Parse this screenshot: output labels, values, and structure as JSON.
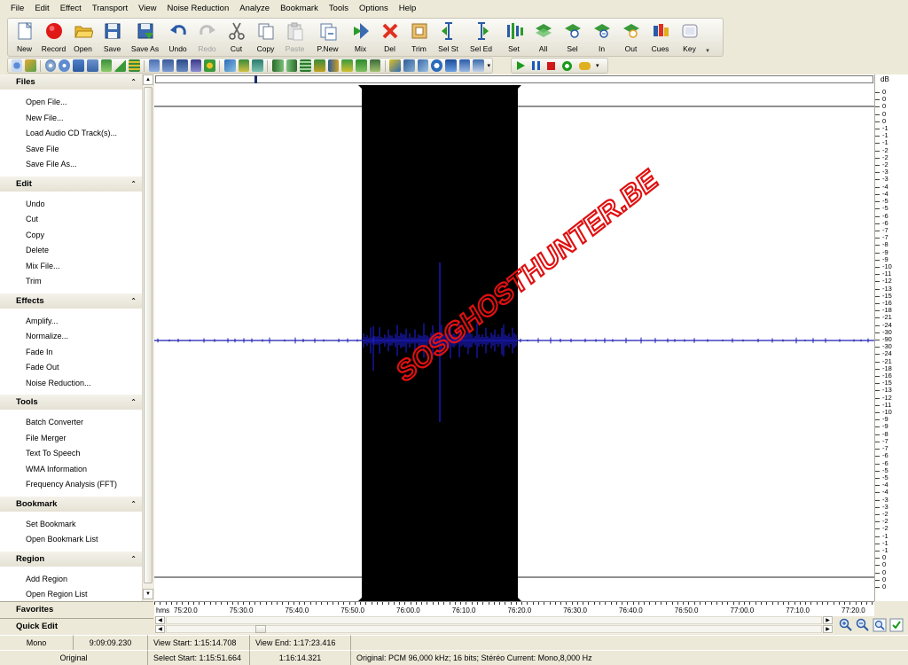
{
  "menu": [
    "File",
    "Edit",
    "Effect",
    "Transport",
    "View",
    "Noise Reduction",
    "Analyze",
    "Bookmark",
    "Tools",
    "Options",
    "Help"
  ],
  "toolbar": [
    {
      "id": "new",
      "label": "New",
      "icon": "new-file-icon",
      "enabled": true
    },
    {
      "id": "record",
      "label": "Record",
      "icon": "record-icon",
      "enabled": true
    },
    {
      "id": "open",
      "label": "Open",
      "icon": "folder-open-icon",
      "enabled": true
    },
    {
      "id": "save",
      "label": "Save",
      "icon": "floppy-save-icon",
      "enabled": true
    },
    {
      "id": "save_as",
      "label": "Save As",
      "icon": "save-as-icon",
      "enabled": true
    },
    {
      "id": "undo",
      "label": "Undo",
      "icon": "undo-icon",
      "enabled": true
    },
    {
      "id": "redo",
      "label": "Redo",
      "icon": "redo-icon",
      "enabled": false
    },
    {
      "id": "cut",
      "label": "Cut",
      "icon": "scissors-icon",
      "enabled": true
    },
    {
      "id": "copy",
      "label": "Copy",
      "icon": "copy-icon",
      "enabled": true
    },
    {
      "id": "paste",
      "label": "Paste",
      "icon": "paste-icon",
      "enabled": false
    },
    {
      "id": "p_new",
      "label": "P.New",
      "icon": "paste-new-icon",
      "enabled": true
    },
    {
      "id": "mix",
      "label": "Mix",
      "icon": "mix-icon",
      "enabled": true
    },
    {
      "id": "del",
      "label": "Del",
      "icon": "delete-x-icon",
      "enabled": true
    },
    {
      "id": "trim",
      "label": "Trim",
      "icon": "trim-icon",
      "enabled": true
    },
    {
      "id": "sel_st",
      "label": "Sel St",
      "icon": "select-start-icon",
      "enabled": true
    },
    {
      "id": "sel_ed",
      "label": "Sel Ed",
      "icon": "select-end-icon",
      "enabled": true
    },
    {
      "id": "set",
      "label": "Set",
      "icon": "set-bookmark-icon",
      "enabled": true
    },
    {
      "id": "all",
      "label": "All",
      "icon": "select-all-icon",
      "enabled": true
    },
    {
      "id": "sel",
      "label": "Sel",
      "icon": "zoom-selection-icon",
      "enabled": true
    },
    {
      "id": "in",
      "label": "In",
      "icon": "zoom-in-icon",
      "enabled": true
    },
    {
      "id": "out",
      "label": "Out",
      "icon": "zoom-out-icon",
      "enabled": true
    },
    {
      "id": "cues",
      "label": "Cues",
      "icon": "cues-icon",
      "enabled": true
    },
    {
      "id": "key",
      "label": "Key",
      "icon": "key-icon",
      "enabled": true
    }
  ],
  "side_panel": {
    "sections": [
      {
        "title": "Files",
        "items": [
          "Open File...",
          "New File...",
          "Load Audio CD Track(s)...",
          "Save File",
          "Save File As..."
        ]
      },
      {
        "title": "Edit",
        "items": [
          "Undo",
          "Cut",
          "Copy",
          "Delete",
          "Mix File...",
          "Trim"
        ]
      },
      {
        "title": "Effects",
        "items": [
          "Amplify...",
          "Normalize...",
          "Fade In",
          "Fade Out",
          "Noise Reduction..."
        ]
      },
      {
        "title": "Tools",
        "items": [
          "Batch Converter",
          "File Merger",
          "Text To Speech",
          "WMA Information",
          "Frequency Analysis (FFT)"
        ]
      },
      {
        "title": "Bookmark",
        "items": [
          "Set Bookmark",
          "Open Bookmark List"
        ]
      },
      {
        "title": "Region",
        "items": [
          "Add Region",
          "Open Region List"
        ]
      }
    ],
    "favorites": "Favorites",
    "quick_edit": "Quick Edit"
  },
  "watermark": "SOSGHOSTHUNTER.BE",
  "db_scale": {
    "title": "dB",
    "labels": [
      "0",
      "0",
      "0",
      "0",
      "0",
      "-1",
      "-1",
      "-1",
      "-2",
      "-2",
      "-2",
      "-3",
      "-3",
      "-4",
      "-4",
      "-5",
      "-5",
      "-6",
      "-6",
      "-7",
      "-7",
      "-8",
      "-9",
      "-9",
      "-10",
      "-11",
      "-12",
      "-13",
      "-15",
      "-16",
      "-18",
      "-21",
      "-24",
      "-30",
      "-90",
      "-30",
      "-24",
      "-21",
      "-18",
      "-16",
      "-15",
      "-13",
      "-12",
      "-11",
      "-10",
      "-9",
      "-9",
      "-8",
      "-7",
      "-7",
      "-6",
      "-6",
      "-5",
      "-5",
      "-4",
      "-4",
      "-3",
      "-3",
      "-2",
      "-2",
      "-2",
      "-1",
      "-1",
      "-1",
      "0",
      "0",
      "0",
      "0",
      "0"
    ]
  },
  "ruler": {
    "unit": "hms",
    "labels": [
      "75:20.0",
      "75:30.0",
      "75:40.0",
      "75:50.0",
      "76:00.0",
      "76:10.0",
      "76:20.0",
      "76:30.0",
      "76:40.0",
      "76:50.0",
      "77:00.0",
      "77:10.0",
      "77:20.0"
    ]
  },
  "selection": {
    "start_label": "Select Start: 1:15:51.664",
    "end": "1:16:14.321"
  },
  "status": {
    "channel": "Mono",
    "length": "9:09:09.230",
    "view_start": "View Start: 1:15:14.708",
    "view_end": "View End: 1:17:23.416",
    "mode": "Original",
    "select_start": "Select Start: 1:15:51.664",
    "select_end": "1:16:14.321",
    "format": "Original: PCM 96,000 kHz; 16 bits; Stéréo Current: Mono,8,000 Hz"
  },
  "colors": {
    "waveform": "#1a1ab4",
    "selection_bg": "#000000",
    "watermark": "#e01010",
    "panel_bg": "#ece9d8"
  }
}
